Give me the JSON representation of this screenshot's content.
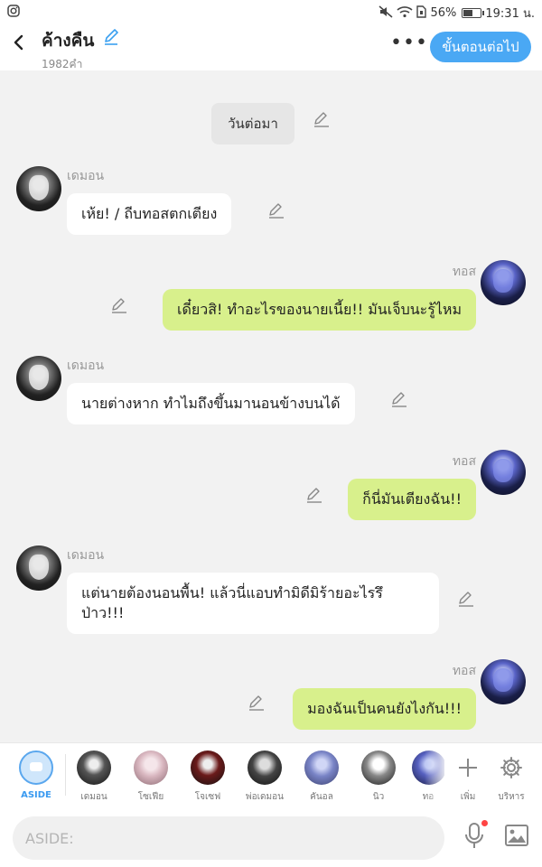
{
  "status_bar": {
    "left_icon": "instagram-icon",
    "battery_percent": "56%",
    "battery_level": 0.56,
    "time": "19:31 น."
  },
  "header": {
    "title": "ค้างคืน",
    "word_count": "1982คำ",
    "next_step_label": "ขั้นตอนต่อไป",
    "more_label": "•••"
  },
  "chat": {
    "narration": "วันต่อมา",
    "messages": [
      {
        "speaker": "เดมอน",
        "text": "เห้ย! / ถีบทอสตกเตียง",
        "side": "left"
      },
      {
        "speaker": "ทอส",
        "text": "เดี๋ยวสิ! ทำอะไรของนายเนี้ย!! มันเจ็บนะรู้ไหม",
        "side": "right"
      },
      {
        "speaker": "เดมอน",
        "text": "นายต่างหาก ทำไมถึงขึ้นมานอนข้างบนได้",
        "side": "left"
      },
      {
        "speaker": "ทอส",
        "text": "ก็นี่มันเตียงฉัน!!",
        "side": "right"
      },
      {
        "speaker": "เดมอน",
        "text": "แต่นายต้องนอนพื้น! แล้วนี่แอบทำมิดีมิร้ายอะไรรึป่าว!!!",
        "side": "left"
      },
      {
        "speaker": "ทอส",
        "text": "มองฉันเป็นคนยังไงกัน!!!",
        "side": "right"
      }
    ]
  },
  "character_bar": {
    "aside_label": "ASIDE",
    "characters": [
      "เดมอน",
      "โซเฟีย",
      "โจเซฟ",
      "พ่อเดมอน",
      "คันอล",
      "นิว",
      "ทอ"
    ],
    "add_label": "เพิ่ม",
    "manage_label": "บริหาร"
  },
  "input_bar": {
    "placeholder": "ASIDE:"
  },
  "colors": {
    "accent": "#4aa8f4",
    "right_bubble": "#d8f08c",
    "left_bubble": "#ffffff",
    "background": "#f2f2f2"
  }
}
